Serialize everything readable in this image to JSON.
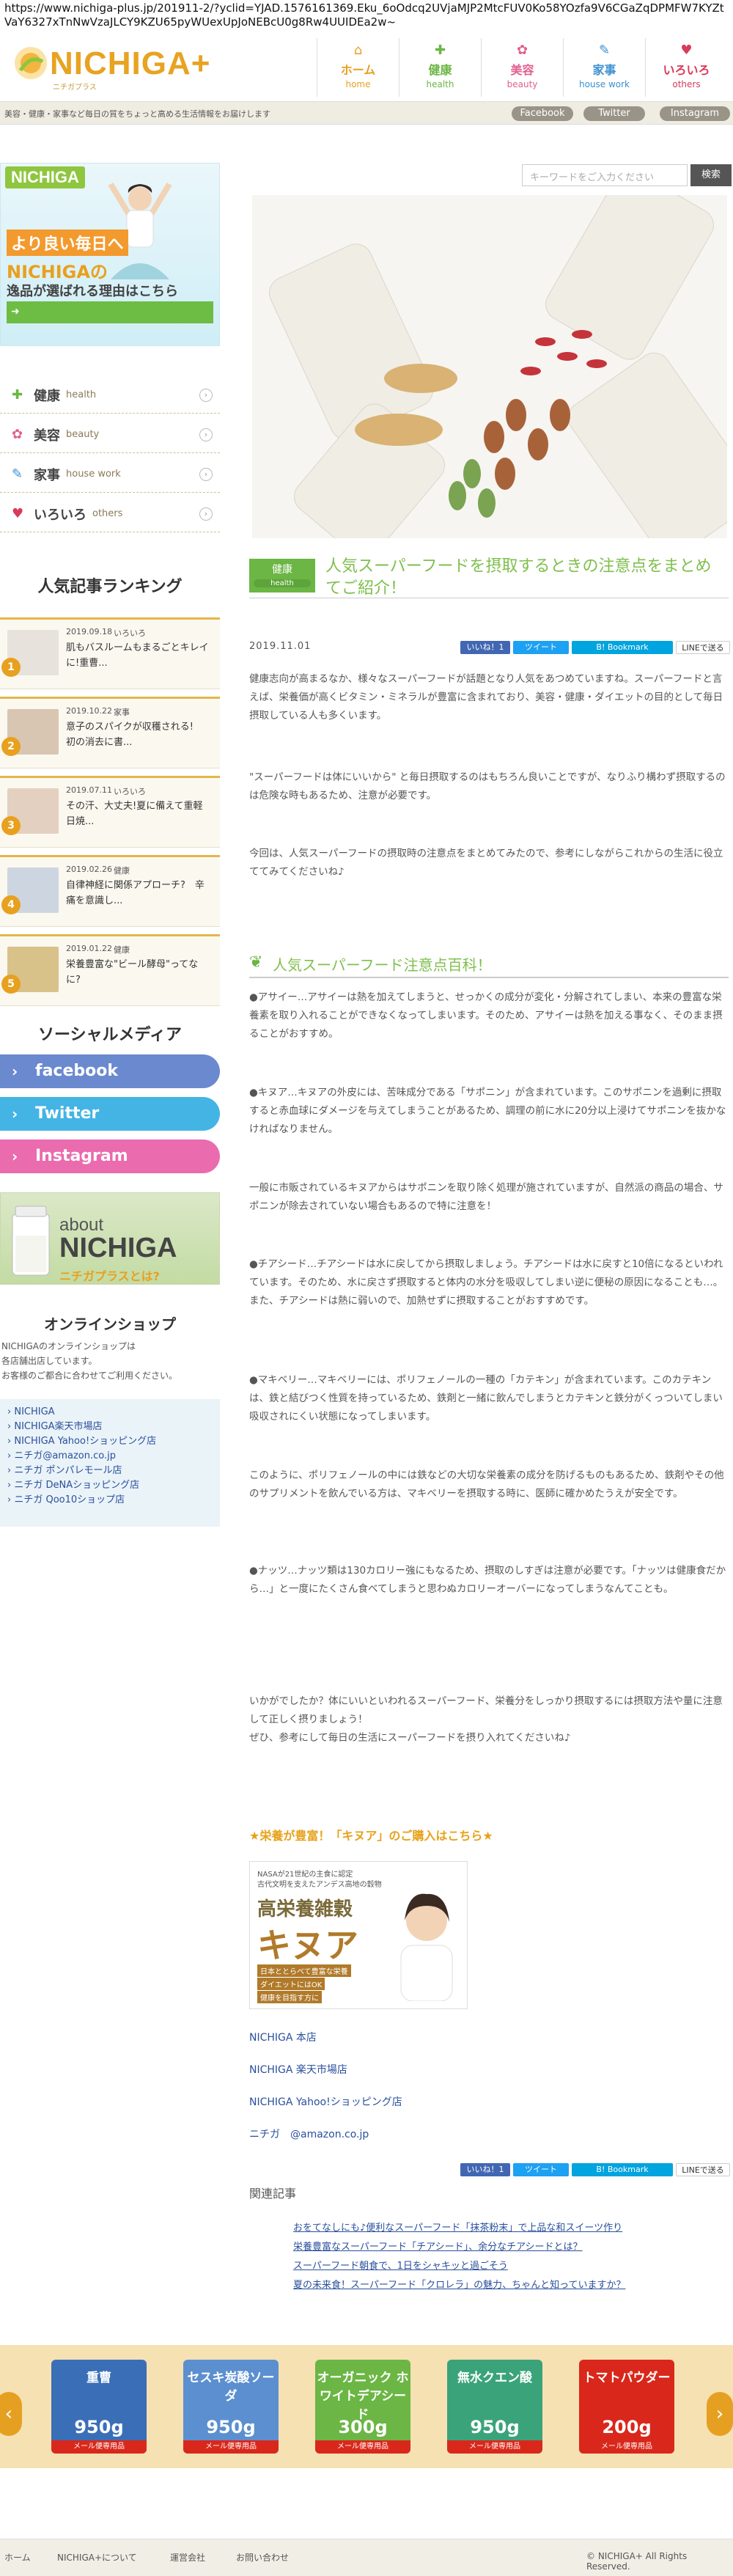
{
  "browser": {
    "url": "https://www.nichiga-plus.jp/201911-2/?yclid=YJAD.1576161369.Eku_6oOdcq2UVjaMJP2MtcFUV0Ko58YOzfa9V6CGaZqDPMFW7KYZtVaY6327xTnNwVzaJLCY9KZU65pyWUexUpJoNEBcU0g8Rw4UUIDEa2w~"
  },
  "header": {
    "logo_text": "NICHIGA+",
    "logo_tag": "ニチガプラス",
    "tagline": "美容・健康・家事など毎日の質をちょっと高める生活情報をお届けします",
    "nav": [
      {
        "jp": "ホーム",
        "en": "home",
        "icon": "house-icon",
        "color": "#e6a021"
      },
      {
        "jp": "健康",
        "en": "health",
        "icon": "health-icon",
        "color": "#6bb644"
      },
      {
        "jp": "美容",
        "en": "beauty",
        "icon": "beauty-icon",
        "color": "#e0608f"
      },
      {
        "jp": "家事",
        "en": "house work",
        "icon": "housework-icon",
        "color": "#3b8fd1"
      },
      {
        "jp": "いろいろ",
        "en": "others",
        "icon": "heart-icon",
        "color": "#d83a5a"
      }
    ],
    "social_buttons": [
      "Facebook",
      "Twitter",
      "Instagram"
    ]
  },
  "sidebar": {
    "banner": {
      "logo": "NICHIGA",
      "line1": "より良い毎日へ",
      "line2": "NICHIGAの",
      "line3": "逸品が選ばれる理由はこちら",
      "arrow": "➜"
    },
    "categories": [
      {
        "jp": "健康",
        "en": "health",
        "icon": "health-icon",
        "color": "#6bb644"
      },
      {
        "jp": "美容",
        "en": "beauty",
        "icon": "beauty-icon",
        "color": "#e0608f"
      },
      {
        "jp": "家事",
        "en": "house work",
        "icon": "housework-icon",
        "color": "#3b8fd1"
      },
      {
        "jp": "いろいろ",
        "en": "others",
        "icon": "heart-icon",
        "color": "#d83a5a"
      }
    ],
    "ranking_title": "人気記事ランキング",
    "ranking": [
      {
        "no": "1",
        "date": "2019.09.18",
        "cat": "いろいろ",
        "title": "肌もバスルームもまるごとキレイに!重曹..."
      },
      {
        "no": "2",
        "date": "2019.10.22",
        "cat": "家事",
        "title": "意子のスパイクが収穫される!　初の消去に書..."
      },
      {
        "no": "3",
        "date": "2019.07.11",
        "cat": "いろいろ",
        "title": "その汗、大丈夫!夏に備えて重軽日焼..."
      },
      {
        "no": "4",
        "date": "2019.02.26",
        "cat": "健康",
        "title": "自律神経に関係アプローチ?　辛痛を意識し..."
      },
      {
        "no": "5",
        "date": "2019.01.22",
        "cat": "健康",
        "title": "栄養豊富な\"ビール酵母\"ってなに?"
      }
    ],
    "social_title": "ソーシャルメディア",
    "social": [
      {
        "label": "facebook",
        "color": "#6a89cf"
      },
      {
        "label": "Twitter",
        "color": "#43b4e4"
      },
      {
        "label": "Instagram",
        "color": "#ea6bae"
      }
    ],
    "about": {
      "line1": "about",
      "line2": "NICHIGA",
      "line3": "ニチガプラスとは?"
    },
    "shop_title": "オンラインショップ",
    "shop_desc": [
      "NICHIGAのオンラインショップは",
      "各店舗出店しています。",
      "お客様のご都合に合わせてご利用ください。"
    ],
    "shop_links": [
      "NICHIGA",
      "NICHIGA楽天市場店",
      "NICHIGA Yahoo!ショッピング店",
      "ニチガ@amazon.co.jp",
      "ニチガ ポンパレモール店",
      "ニチガ DeNAショッピング店",
      "ニチガ Qoo10ショップ店"
    ]
  },
  "search": {
    "placeholder": "キーワードをご入力ください",
    "button": "検索"
  },
  "article": {
    "category_jp": "健康",
    "category_en": "health",
    "title": "人気スーパーフードを摂取するときの注意点をまとめてご紹介！",
    "date": "2019.11.01",
    "share": [
      {
        "label": "いいね！1",
        "color": "#4267b2"
      },
      {
        "label": "ツイート",
        "color": "#1da1f2"
      },
      {
        "label": "B! Bookmark",
        "color": "#00a4de"
      },
      {
        "label": "LINEで送る",
        "color": "#00b900"
      }
    ],
    "intro": [
      "健康志向が高まるなか、様々なスーパーフードが話題となり人気をあつめていますね。スーパーフードと言えば、栄養価が高くビタミン・ミネラルが豊富に含まれており、美容・健康・ダイエットの目的として毎日摂取している人も多くいます。",
      "\"スーパーフードは体にいいから\" と毎日摂取するのはもちろん良いことですが、なりふり構わず摂取するのは危険な時もあるため、注意が必要です。",
      "今回は、人気スーパーフードの摂取時の注意点をまとめてみたので、参考にしながらこれからの生活に役立ててみてくださいね♪"
    ],
    "h2": "人気スーパーフード注意点百科！",
    "body": [
      "●アサイー…アサイーは熱を加えてしまうと、せっかくの成分が変化・分解されてしまい、本来の豊富な栄養素を取り入れることができなくなってしまいます。そのため、アサイーは熱を加える事なく、そのまま摂ることがおすすめ。",
      "●キヌア…キヌアの外皮には、苦味成分である「サポニン」が含まれています。このサポニンを過剰に摂取すると赤血球にダメージを与えてしまうことがあるため、調理の前に水に20分以上浸けてサポニンを抜かなければなりません。",
      "一般に市販されているキヌアからはサポニンを取り除く処理が施されていますが、自然派の商品の場合、サポニンが除去されていない場合もあるので特に注意を！",
      "●チアシード…チアシードは水に戻してから摂取しましょう。チアシードは水に戻すと10倍になるといわれています。そのため、水に戻さず摂取すると体内の水分を吸収してしまい逆に便秘の原因になることも…。また、チアシードは熱に弱いので、加熱せずに摂取することがおすすめです。",
      "●マキベリー…マキベリーには、ポリフェノールの一種の「カテキン」が含まれています。このカテキンは、鉄と結びつく性質を持っているため、鉄剤と一緒に飲んでしまうとカテキンと鉄分がくっついてしまい吸収されにくい状態になってしまいます。",
      "このように、ポリフェノールの中には鉄などの大切な栄養素の成分を防げるものもあるため、鉄剤やその他のサプリメントを飲んでいる方は、マキベリーを摂取する時に、医師に確かめたうえが安全です。",
      "●ナッツ…ナッツ類は130カロリー強にもなるため、摂取のしすぎは注意が必要です。「ナッツは健康食だから…」と一度にたくさん食べてしまうと思わぬカロリーオーバーになってしまうなんてことも。",
      "いかがでしたか？体にいいといわれるスーパーフード、栄養分をしっかり摂取するには摂取方法や量に注意して正しく摂りましょう！\nぜひ、参考にして毎日の生活にスーパーフードを摂り入れてくださいね♪"
    ],
    "promo_title": "★栄養が豊富！「キヌア」のご購入はこちら★",
    "promo_image": {
      "top": "NASAが21世紀の主食に認定",
      "sub": "古代文明を支えたアンデス高地の穀物",
      "main1": "高栄養雑穀",
      "main2": "キヌア",
      "b1": "日本ととらべて豊富な栄養",
      "b2": "ダイエットにはOK",
      "b3": "健康を目指す方に"
    },
    "links": [
      "NICHIGA 本店",
      "NICHIGA 楽天市場店",
      "NICHIGA Yahoo!ショッピング店",
      "ニチガ　@amazon.co.jp"
    ],
    "related_title": "関連記事",
    "related": [
      "おをてなしにも♪便利なスーパーフード「抹茶粉末」で上品な和スイーツ作り",
      "栄養豊富なスーパーフード「チアシード」、余分なチアシードとは？",
      "スーパーフード朝食で、1日をシャキッと過ごそう",
      "夏の未来食！スーパーフード「クロレラ」の魅力、ちゃんと知っていますか？"
    ]
  },
  "carousel": {
    "prev": "‹",
    "next": "›",
    "products": [
      {
        "name": "重曹",
        "weight": "950g",
        "note": "メール便専用品",
        "color": "#3a6fb8"
      },
      {
        "name": "セスキ炭酸ソーダ",
        "weight": "950g",
        "note": "メール便専用品",
        "color": "#5c8fd0"
      },
      {
        "name": "オーガニック ホワイトデアシード",
        "weight": "300g",
        "note": "メール便専用品",
        "color": "#6bb644"
      },
      {
        "name": "無水クエン酸",
        "weight": "950g",
        "note": "メール便専用品",
        "color": "#3ba37a"
      },
      {
        "name": "トマトパウダー",
        "weight": "200g",
        "note": "メール便専用品",
        "color": "#d9281b"
      }
    ]
  },
  "footer": {
    "links": [
      "ホーム",
      "NICHIGA+について",
      "運営会社",
      "お問い合わせ"
    ],
    "copyright": "© NICHIGA+ All Rights Reserved."
  }
}
